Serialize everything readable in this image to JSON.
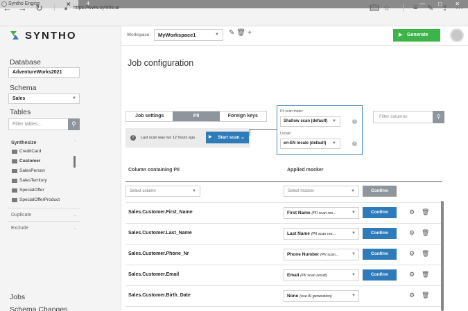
{
  "browser": {
    "tab_title": "Syntho Engine",
    "tab_close": "✕",
    "new_tab": "+",
    "url": "https://www.syntho.ai",
    "window_controls": "— ◻ ✕"
  },
  "sidebar": {
    "logo": "SYNTHO",
    "database_heading": "Database",
    "database_value": "AdventureWorks2021",
    "schema_heading": "Schema",
    "schema_value": "Sales",
    "tables_heading": "Tables",
    "filter_placeholder": "Filter tables...",
    "groups": {
      "synthesize": "Synthesize",
      "duplicate": "Duplicate",
      "exclude": "Exclude"
    },
    "tables": [
      "CreditCard",
      "Customer",
      "SalesPerson",
      "SalesTerritory",
      "SpecialOffer",
      "SpecialOfferProduct"
    ],
    "jobs": "Jobs",
    "schema_changes": "Schema Changes"
  },
  "topbar": {
    "workspace_label": "Workspace:",
    "workspace_value": "MyWorkspace1",
    "generate_label": "Generate"
  },
  "main": {
    "title": "Job configuration",
    "tabs": [
      "Job settings",
      "PII",
      "Foreign keys"
    ],
    "scan_message": "Last scan was run 12 hours ago.",
    "start_scan_label": "Start scan",
    "pii_panel": {
      "scan_mode_label": "PII scan mode:",
      "scan_mode_value": "Shallow scan (default)",
      "locale_label": "Locale:",
      "locale_value": "en-EN locale (default)"
    },
    "filter_columns_placeholder": "Filter columns",
    "col_header_pii": "Column containing PII",
    "col_header_mocker": "Applied mocker",
    "select_column_placeholder": "Select column",
    "select_mocker_placeholder": "Select mocker",
    "confirm_label": "Confirm",
    "rows": [
      {
        "name": "Sales.Customer.First_Name",
        "mocker": "First Name",
        "note": "(PII scan res..."
      },
      {
        "name": "Sales.Customer.Last_Name",
        "mocker": "Last Name",
        "note": "(PII scan res..."
      },
      {
        "name": "Sales.Customer.Phone_Nr",
        "mocker": "Phone Number",
        "note": "(PII scan..."
      },
      {
        "name": "Sales.Customer.Email",
        "mocker": "Email",
        "note": "(PII scan result)"
      },
      {
        "name": "Sales.Customer.Birth_Date",
        "mocker": "None",
        "note": "(use AI generation)"
      }
    ]
  },
  "colors": {
    "accent_blue": "#2f7ab8",
    "generate_green": "#3cb44a",
    "active_tab_grey": "#8f959d"
  }
}
